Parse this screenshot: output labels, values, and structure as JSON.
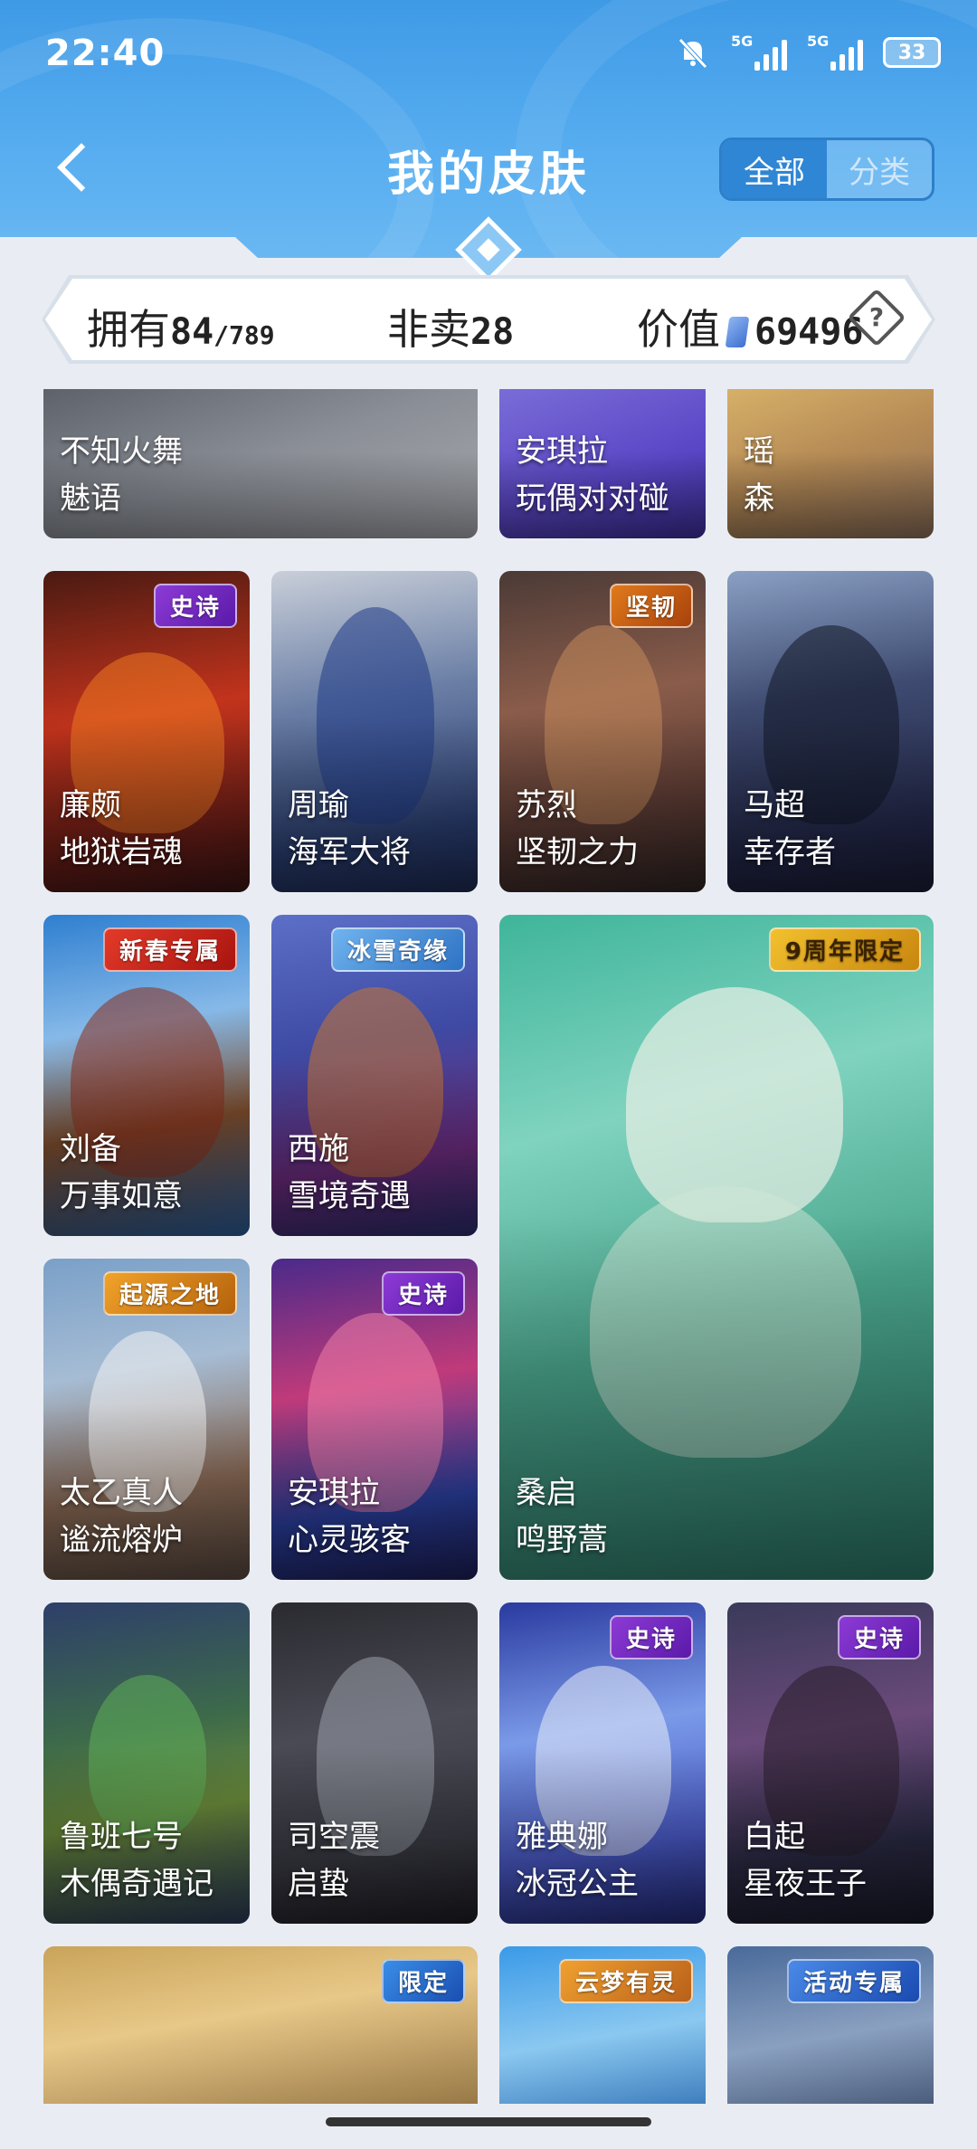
{
  "status_bar": {
    "time": "22:40",
    "signal1": "5G",
    "signal2": "5G",
    "battery": "33"
  },
  "header": {
    "title": "我的皮肤",
    "tabs": [
      "全部",
      "分类"
    ],
    "active_tab": "全部"
  },
  "stats": {
    "owned_label": "拥有",
    "owned": "84",
    "total": "/789",
    "notsale_label": "非卖",
    "notsale": "28",
    "value_label": "价值",
    "value": "69496",
    "help": "?"
  },
  "cards": [
    {
      "hero": "不知火舞",
      "skin": "魅语",
      "badge": ""
    },
    {
      "hero": "安琪拉",
      "skin": "玩偶对对碰",
      "badge": ""
    },
    {
      "hero": "瑶",
      "skin": "森",
      "badge": ""
    },
    {
      "hero": "廉颇",
      "skin": "地狱岩魂",
      "badge": "史诗"
    },
    {
      "hero": "周瑜",
      "skin": "海军大将",
      "badge": ""
    },
    {
      "hero": "苏烈",
      "skin": "坚韧之力",
      "badge": "坚韧"
    },
    {
      "hero": "马超",
      "skin": "幸存者",
      "badge": ""
    },
    {
      "hero": "刘备",
      "skin": "万事如意",
      "badge": "新春专属"
    },
    {
      "hero": "西施",
      "skin": "雪境奇遇",
      "badge": "冰雪奇缘"
    },
    {
      "hero": "桑启",
      "skin": "鸣野蒿",
      "badge": "9周年限定"
    },
    {
      "hero": "太乙真人",
      "skin": "谧流熔炉",
      "badge": "起源之地"
    },
    {
      "hero": "安琪拉",
      "skin": "心灵骇客",
      "badge": "史诗"
    },
    {
      "hero": "鲁班七号",
      "skin": "木偶奇遇记",
      "badge": ""
    },
    {
      "hero": "司空震",
      "skin": "启蛰",
      "badge": ""
    },
    {
      "hero": "雅典娜",
      "skin": "冰冠公主",
      "badge": "史诗"
    },
    {
      "hero": "白起",
      "skin": "星夜王子",
      "badge": "史诗"
    },
    {
      "hero": "",
      "skin": "",
      "badge": "限定"
    },
    {
      "hero": "",
      "skin": "",
      "badge": "云梦有灵"
    },
    {
      "hero": "",
      "skin": "",
      "badge": "活动专属"
    }
  ]
}
